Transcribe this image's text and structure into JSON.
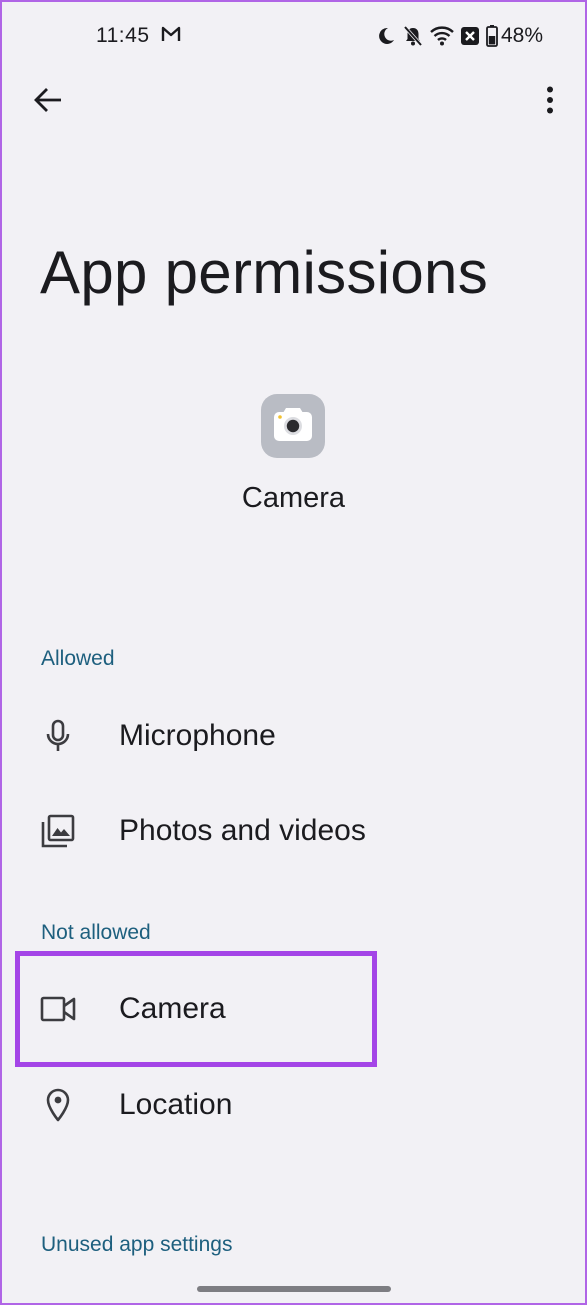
{
  "status_bar": {
    "time": "11:45",
    "battery": "48%",
    "icons": [
      "gmail-icon",
      "do-not-disturb-moon-icon",
      "notifications-off-icon",
      "wifi-icon",
      "no-sim-icon",
      "battery-icon"
    ]
  },
  "toolbar": {
    "back_icon": "arrow-back-icon",
    "more_icon": "more-vert-icon"
  },
  "page": {
    "title": "App permissions",
    "app_name": "Camera",
    "app_icon": "camera-app-icon"
  },
  "sections": {
    "allowed": {
      "header": "Allowed",
      "items": [
        {
          "label": "Microphone",
          "icon": "microphone-icon"
        },
        {
          "label": "Photos and videos",
          "icon": "photos-icon"
        }
      ]
    },
    "not_allowed": {
      "header": "Not allowed",
      "items": [
        {
          "label": "Camera",
          "icon": "videocam-icon"
        },
        {
          "label": "Location",
          "icon": "location-pin-icon"
        }
      ]
    },
    "unused": {
      "header": "Unused app settings"
    }
  },
  "colors": {
    "background": "#f2f1f5",
    "section_header": "#1d5f7e",
    "highlight": "#a445e7"
  }
}
